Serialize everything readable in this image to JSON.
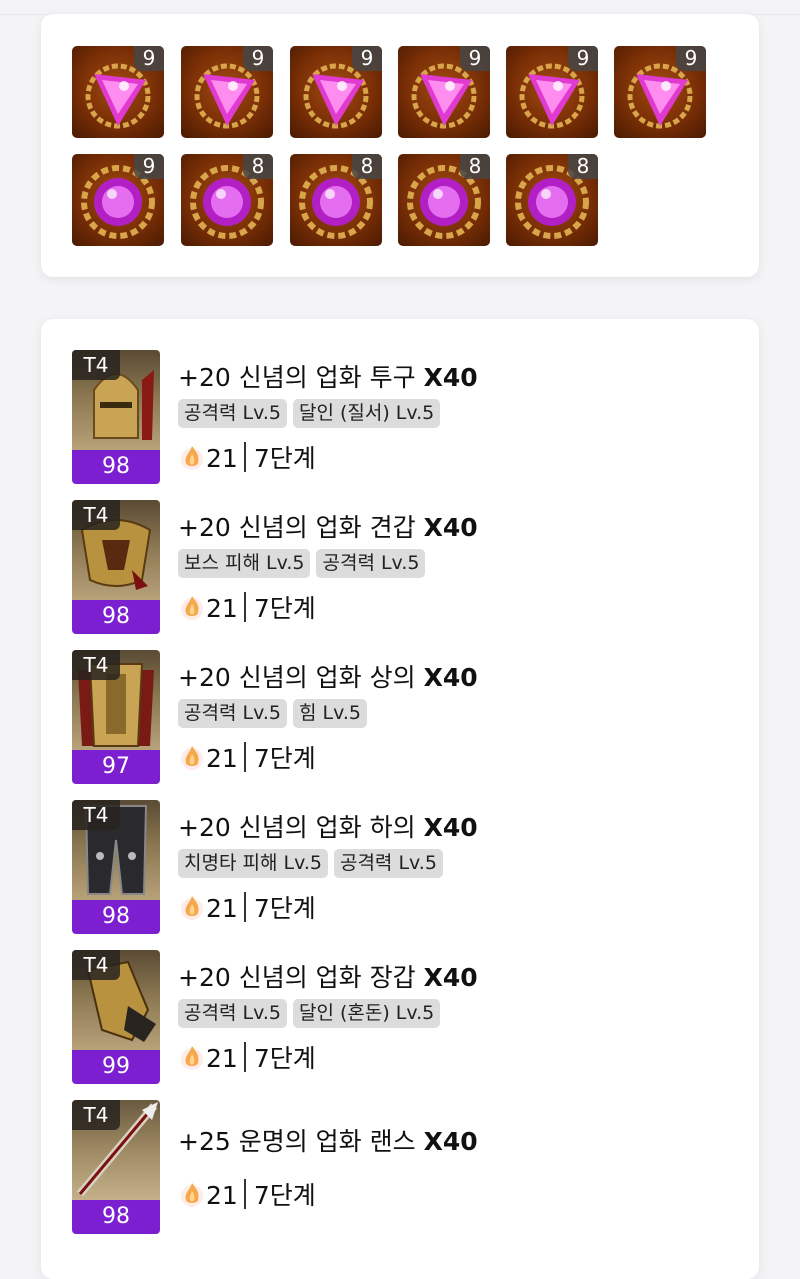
{
  "gems": [
    {
      "type": "annihilation",
      "level": "9"
    },
    {
      "type": "annihilation",
      "level": "9"
    },
    {
      "type": "annihilation",
      "level": "9"
    },
    {
      "type": "annihilation",
      "level": "9"
    },
    {
      "type": "annihilation",
      "level": "9"
    },
    {
      "type": "annihilation",
      "level": "9"
    },
    {
      "type": "crimson",
      "level": "9"
    },
    {
      "type": "crimson",
      "level": "8"
    },
    {
      "type": "crimson",
      "level": "8"
    },
    {
      "type": "crimson",
      "level": "8"
    },
    {
      "type": "crimson",
      "level": "8"
    }
  ],
  "equipment": [
    {
      "tier": "T4",
      "quality": "98",
      "name": "+20 신념의 업화 투구",
      "multiplier": "X40",
      "tags": [
        "공격력 Lv.5",
        "달인 (질서) Lv.5"
      ],
      "elixir": "21",
      "stage": "7단계",
      "icon": "helmet-icon"
    },
    {
      "tier": "T4",
      "quality": "98",
      "name": "+20 신념의 업화 견갑",
      "multiplier": "X40",
      "tags": [
        "보스 피해 Lv.5",
        "공격력 Lv.5"
      ],
      "elixir": "21",
      "stage": "7단계",
      "icon": "shoulder-icon"
    },
    {
      "tier": "T4",
      "quality": "97",
      "name": "+20 신념의 업화 상의",
      "multiplier": "X40",
      "tags": [
        "공격력 Lv.5",
        "힘 Lv.5"
      ],
      "elixir": "21",
      "stage": "7단계",
      "icon": "chest-icon"
    },
    {
      "tier": "T4",
      "quality": "98",
      "name": "+20 신념의 업화 하의",
      "multiplier": "X40",
      "tags": [
        "치명타 피해 Lv.5",
        "공격력 Lv.5"
      ],
      "elixir": "21",
      "stage": "7단계",
      "icon": "pants-icon"
    },
    {
      "tier": "T4",
      "quality": "99",
      "name": "+20 신념의 업화 장갑",
      "multiplier": "X40",
      "tags": [
        "공격력 Lv.5",
        "달인 (혼돈) Lv.5"
      ],
      "elixir": "21",
      "stage": "7단계",
      "icon": "gloves-icon"
    },
    {
      "tier": "T4",
      "quality": "98",
      "name": "+25 운명의 업화 랜스",
      "multiplier": "X40",
      "tags": [],
      "elixir": "21",
      "stage": "7단계",
      "icon": "lance-icon"
    }
  ],
  "colors": {
    "quality_bar": "#7c1fd0",
    "tag_bg": "#dcdcdc",
    "gem_bg": "#7a2f06"
  }
}
